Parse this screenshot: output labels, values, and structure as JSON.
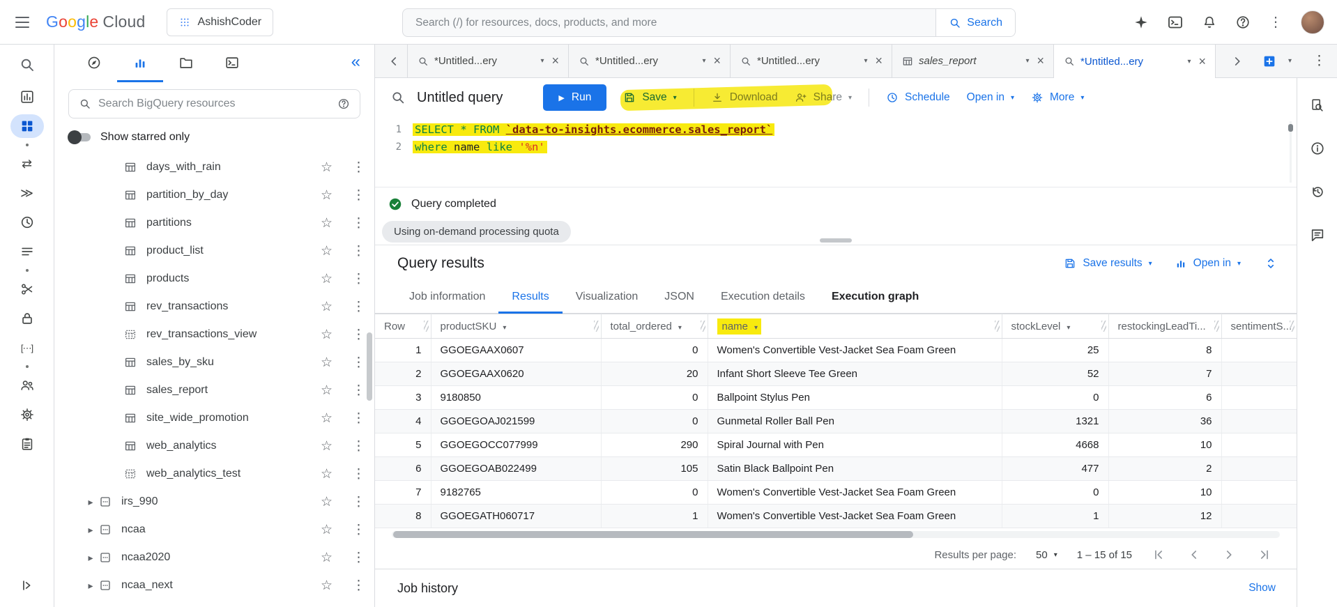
{
  "header": {
    "google_logo": "Google",
    "cloud_logo": "Cloud",
    "project_name": "AshishCoder",
    "search_placeholder": "Search (/) for resources, docs, products, and more",
    "search_button_label": "Search"
  },
  "left_rail": {
    "icons": [
      "bigquery-logo",
      "analysis-icon",
      "workspace-icon",
      "dot",
      "transfers-icon",
      "scheduled-queries-icon",
      "history-icon",
      "saved-queries-icon",
      "dot",
      "data-prep-icon",
      "governance-icon",
      "migration-icon",
      "dot",
      "sharing-icon",
      "admin-icon",
      "monitoring-icon"
    ],
    "active_icon": "workspace-icon"
  },
  "explorer": {
    "search_placeholder": "Search BigQuery resources",
    "starred_toggle_label": "Show starred only",
    "tables": [
      {
        "label": "days_with_rain",
        "icon": "table"
      },
      {
        "label": "partition_by_day",
        "icon": "table"
      },
      {
        "label": "partitions",
        "icon": "table"
      },
      {
        "label": "product_list",
        "icon": "table"
      },
      {
        "label": "products",
        "icon": "table"
      },
      {
        "label": "rev_transactions",
        "icon": "table"
      },
      {
        "label": "rev_transactions_view",
        "icon": "view"
      },
      {
        "label": "sales_by_sku",
        "icon": "table"
      },
      {
        "label": "sales_report",
        "icon": "table"
      },
      {
        "label": "site_wide_promotion",
        "icon": "table"
      },
      {
        "label": "web_analytics",
        "icon": "table"
      },
      {
        "label": "web_analytics_test",
        "icon": "view"
      }
    ],
    "datasets": [
      {
        "label": "irs_990"
      },
      {
        "label": "ncaa"
      },
      {
        "label": "ncaa2020"
      },
      {
        "label": "ncaa_next"
      }
    ]
  },
  "tab_bar": {
    "tabs": [
      {
        "label": "*Untitled...ery",
        "type": "query",
        "active": false
      },
      {
        "label": "*Untitled...ery",
        "type": "query",
        "active": false
      },
      {
        "label": "*Untitled...ery",
        "type": "query",
        "active": false
      },
      {
        "label": "sales_report",
        "type": "table",
        "active": false
      },
      {
        "label": "*Untitled...ery",
        "type": "query",
        "active": true
      }
    ]
  },
  "editor": {
    "title": "Untitled query",
    "run_label": "Run",
    "save_label": "Save",
    "download_label": "Download",
    "share_label": "Share",
    "schedule_label": "Schedule",
    "open_in_label": "Open in",
    "more_label": "More",
    "code": {
      "line1": {
        "num": "1",
        "keywords": "SELECT * FROM",
        "table_ref": "`data-to-insights.ecommerce.sales_report`"
      },
      "line2": {
        "num": "2",
        "kw_where": "where",
        "column": "name",
        "kw_like": "like",
        "pattern": "'%n'"
      }
    },
    "status_text": "Query completed",
    "quota_chip": "Using on-demand processing quota"
  },
  "results": {
    "title": "Query results",
    "save_results_label": "Save results",
    "open_in_label": "Open in",
    "tabs": [
      {
        "label": "Job information",
        "active": false,
        "emphasized": false
      },
      {
        "label": "Results",
        "active": true,
        "emphasized": false
      },
      {
        "label": "Visualization",
        "active": false,
        "emphasized": false
      },
      {
        "label": "JSON",
        "active": false,
        "emphasized": false
      },
      {
        "label": "Execution details",
        "active": false,
        "emphasized": false
      },
      {
        "label": "Execution graph",
        "active": false,
        "emphasized": true
      }
    ],
    "table": {
      "columns": [
        {
          "label": "Row",
          "sortable": false,
          "highlighted": false
        },
        {
          "label": "productSKU",
          "sortable": true,
          "highlighted": false
        },
        {
          "label": "total_ordered",
          "sortable": true,
          "highlighted": false
        },
        {
          "label": "name",
          "sortable": true,
          "highlighted": true
        },
        {
          "label": "stockLevel",
          "sortable": true,
          "highlighted": false
        },
        {
          "label": "restockingLeadTi...",
          "sortable": false,
          "highlighted": false
        },
        {
          "label": "sentimentS...",
          "sortable": false,
          "highlighted": false
        }
      ],
      "rows": [
        [
          "1",
          "GGOEGAAX0607",
          "0",
          "Women's Convertible Vest-Jacket Sea Foam Green",
          "25",
          "8",
          ""
        ],
        [
          "2",
          "GGOEGAAX0620",
          "20",
          "Infant Short Sleeve Tee Green",
          "52",
          "7",
          ""
        ],
        [
          "3",
          "9180850",
          "0",
          "Ballpoint Stylus Pen",
          "0",
          "6",
          ""
        ],
        [
          "4",
          "GGOEGOAJ021599",
          "0",
          "Gunmetal Roller Ball Pen",
          "1321",
          "36",
          ""
        ],
        [
          "5",
          "GGOEGOCC077999",
          "290",
          "Spiral Journal with Pen",
          "4668",
          "10",
          ""
        ],
        [
          "6",
          "GGOEGOAB022499",
          "105",
          "Satin Black Ballpoint Pen",
          "477",
          "2",
          ""
        ],
        [
          "7",
          "9182765",
          "0",
          "Women's Convertible Vest-Jacket Sea Foam Green",
          "0",
          "10",
          ""
        ],
        [
          "8",
          "GGOEGATH060717",
          "1",
          "Women's Convertible Vest-Jacket Sea Foam Green",
          "1",
          "12",
          ""
        ]
      ]
    },
    "pagination": {
      "label": "Results per page:",
      "per_page": "50",
      "range": "1 – 15 of 15"
    }
  },
  "job_history": {
    "title": "Job history",
    "show_label": "Show"
  },
  "colors": {
    "accent_blue": "#1a73e8",
    "highlight_yellow": "#f8ea0e",
    "success_green": "#188038"
  }
}
